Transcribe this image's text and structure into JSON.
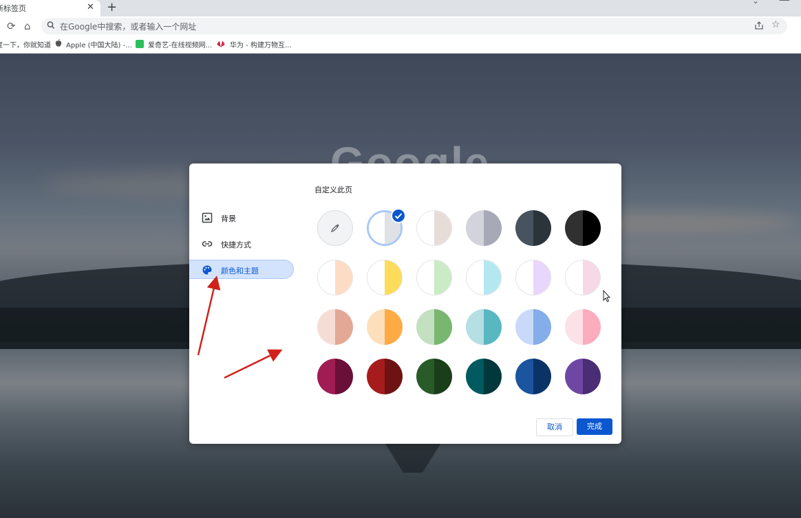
{
  "tab": {
    "title": "新标签页",
    "close": "✕",
    "new_tab": "+"
  },
  "toolbar": {
    "reload": "⟳",
    "home": "⌂",
    "omnibox_placeholder": "在Google中搜索，或者输入一个网址",
    "star": "☆"
  },
  "bookmarks": [
    {
      "label": "百度一下，你就知道",
      "icon": "baidu-icon"
    },
    {
      "label": "Apple (中国大陆) -...",
      "icon": "apple-icon"
    },
    {
      "label": "爱奇艺-在线视频网...",
      "icon": "iqiyi-icon"
    },
    {
      "label": "华为 - 构建万物互...",
      "icon": "huawei-icon"
    }
  ],
  "background": {
    "logo_text": "Google"
  },
  "dialog": {
    "title": "自定义此页",
    "nav": [
      {
        "label": "背景",
        "icon": "image-icon"
      },
      {
        "label": "快捷方式",
        "icon": "link-icon"
      },
      {
        "label": "颜色和主题",
        "icon": "palette-icon",
        "active": true
      }
    ],
    "swatches": [
      {
        "name": "color-picker",
        "picker": true
      },
      {
        "name": "default",
        "left": "#ffffff",
        "right": "#dee1e6",
        "selected": true
      },
      {
        "name": "warm-grey",
        "left": "#ffffff",
        "right": "#e6ddd9"
      },
      {
        "name": "cool-grey",
        "left": "#d3d4db",
        "right": "#a7aab6"
      },
      {
        "name": "midnight-blue",
        "left": "#47535e",
        "right": "#2c343b"
      },
      {
        "name": "black",
        "left": "#303030",
        "right": "#000000"
      },
      {
        "name": "beige-white",
        "left": "#ffffff",
        "right": "#fddcc5"
      },
      {
        "name": "yellow-white",
        "left": "#ffffff",
        "right": "#fddc5b"
      },
      {
        "name": "green-white",
        "left": "#ffffff",
        "right": "#cbeac6"
      },
      {
        "name": "light-teal-white",
        "left": "#ffffff",
        "right": "#b4e8f1"
      },
      {
        "name": "light-purple-white",
        "left": "#ffffff",
        "right": "#e8d6fd"
      },
      {
        "name": "pink-white",
        "left": "#ffffff",
        "right": "#f7d8e6"
      },
      {
        "name": "beige",
        "left": "#f5ddd6",
        "right": "#e3a896"
      },
      {
        "name": "orange",
        "left": "#fde0bb",
        "right": "#feab45"
      },
      {
        "name": "light-green",
        "left": "#c3e0c0",
        "right": "#79b771"
      },
      {
        "name": "light-teal",
        "left": "#b5dfe2",
        "right": "#59b7c1"
      },
      {
        "name": "light-blue",
        "left": "#c8daf8",
        "right": "#84ade9"
      },
      {
        "name": "light-pink",
        "left": "#fde1e8",
        "right": "#fbacbd"
      },
      {
        "name": "dark-pink-red",
        "left": "#a01d53",
        "right": "#6a0f38"
      },
      {
        "name": "dark-red-orange",
        "left": "#a61c1c",
        "right": "#6e1313"
      },
      {
        "name": "dark-green",
        "left": "#285b28",
        "right": "#1a3d1a"
      },
      {
        "name": "dark-teal",
        "left": "#005a60",
        "right": "#00383c"
      },
      {
        "name": "dark-blue",
        "left": "#1a559e",
        "right": "#0b3366"
      },
      {
        "name": "purple",
        "left": "#6e47a5",
        "right": "#4a2d74"
      }
    ],
    "cancel": "取消",
    "done": "完成"
  },
  "colors": {
    "accent": "#0b57d0",
    "active_bg": "#d3e3fd",
    "annotation_arrow": "#d0221b"
  }
}
